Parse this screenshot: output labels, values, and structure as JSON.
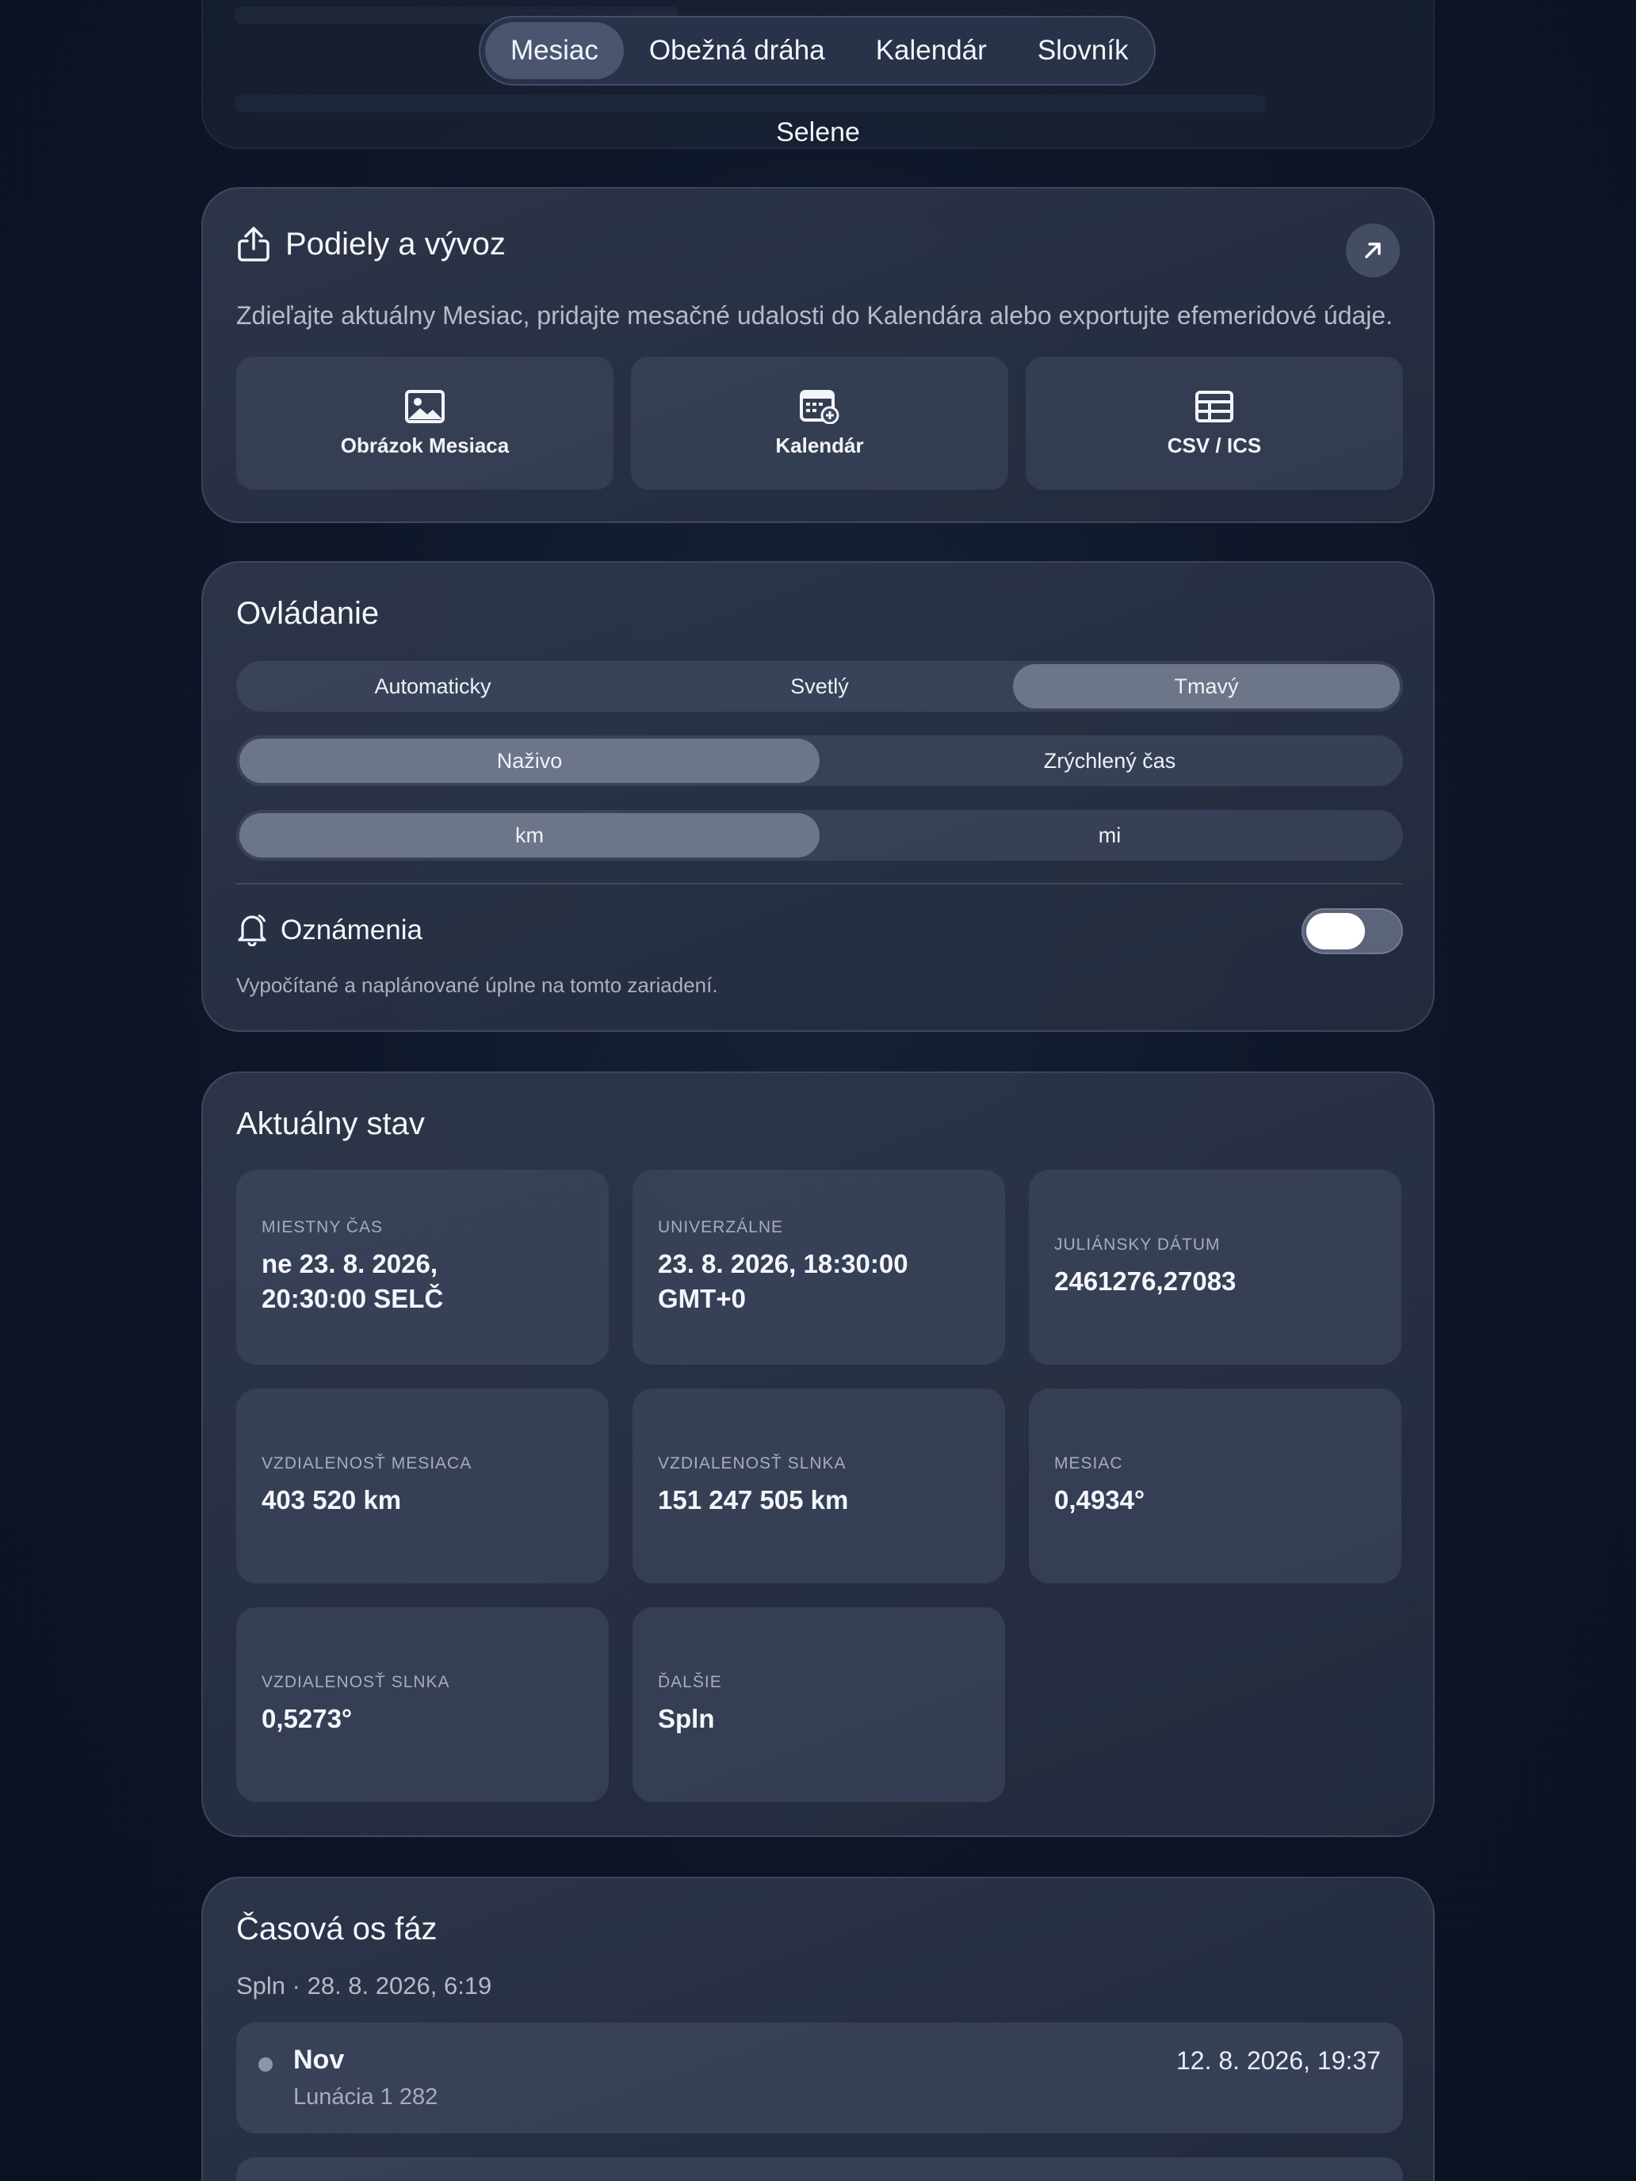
{
  "nav": {
    "tabs": [
      {
        "label": "Mesiac",
        "active": true
      },
      {
        "label": "Obežná dráha",
        "active": false
      },
      {
        "label": "Kalendár",
        "active": false
      },
      {
        "label": "Slovník",
        "active": false
      }
    ],
    "subtitle": "Selene"
  },
  "share": {
    "title": "Podiely a vývoz",
    "description": "Zdieľajte aktuálny Mesiac, pridajte mesačné udalosti do Kalendára alebo exportujte efemeridové údaje.",
    "open_icon": "arrow-up-right-icon",
    "tiles": [
      {
        "label": "Obrázok Mesiaca",
        "icon": "image-icon"
      },
      {
        "label": "Kalendár",
        "icon": "calendar-add-icon"
      },
      {
        "label": "CSV / ICS",
        "icon": "table-icon"
      }
    ]
  },
  "controls": {
    "title": "Ovládanie",
    "theme": {
      "options": [
        "Automaticky",
        "Svetlý",
        "Tmavý"
      ],
      "selected": "Tmavý"
    },
    "time": {
      "options": [
        "Naživo",
        "Zrýchlený čas"
      ],
      "selected": "Naživo"
    },
    "units": {
      "options": [
        "km",
        "mi"
      ],
      "selected": "km"
    },
    "notifications": {
      "label": "Oznámenia",
      "description": "Vypočítané a naplánované úplne na tomto zariadení.",
      "enabled": false
    }
  },
  "status": {
    "title": "Aktuálny stav",
    "stats": [
      {
        "label": "MIESTNY ČAS",
        "value": "ne 23. 8. 2026,\n20:30:00 SELČ"
      },
      {
        "label": "UNIVERZÁLNE",
        "value": "23. 8. 2026, 18:30:00\nGMT+0"
      },
      {
        "label": "JULIÁNSKY DÁTUM",
        "value": "2461276,27083"
      },
      {
        "label": "VZDIALENOSŤ MESIACA",
        "value": "403 520 km"
      },
      {
        "label": "VZDIALENOSŤ SLNKA",
        "value": "151 247 505 km"
      },
      {
        "label": "MESIAC",
        "value": "0,4934°"
      },
      {
        "label": "VZDIALENOSŤ SLNKA",
        "value": "0,5273°"
      },
      {
        "label": "ĎALŠIE",
        "value": "Spln"
      }
    ]
  },
  "timeline": {
    "title": "Časová os fáz",
    "next": "Spln · 28. 8. 2026, 6:19",
    "events": [
      {
        "name": "Nov",
        "date": "12. 8. 2026, 19:37",
        "lunation": "Lunácia 1 282"
      }
    ]
  },
  "colors": {
    "background": "#0e1628",
    "card": "#2c3446",
    "accent_active": "#6d7588"
  }
}
